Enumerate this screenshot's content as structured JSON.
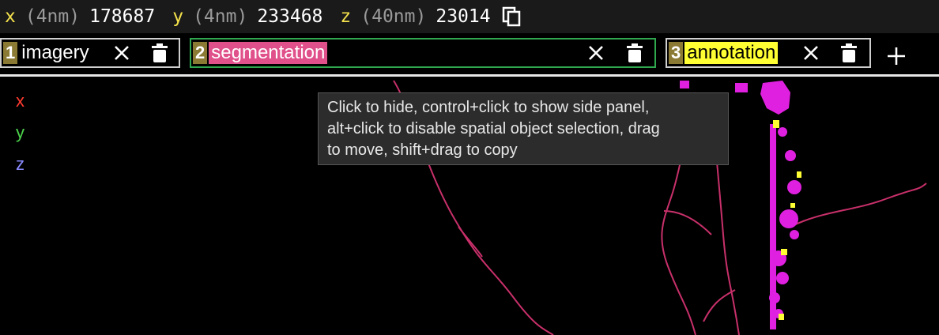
{
  "coordinates": [
    {
      "axis": "x",
      "unit": "(4nm)",
      "value": "178687"
    },
    {
      "axis": "y",
      "unit": "(4nm)",
      "value": "233468"
    },
    {
      "axis": "z",
      "unit": "(40nm)",
      "value": "23014"
    }
  ],
  "layers": [
    {
      "number": "1",
      "name": "imagery",
      "name_bg": "#000000",
      "name_color": "#ffffff"
    },
    {
      "number": "2",
      "name": "segmentation",
      "name_bg": "#e0508a",
      "name_color": "#ffffff",
      "border": "#2fa84f"
    },
    {
      "number": "3",
      "name": "annotation",
      "name_bg": "#ffff33",
      "name_color": "#000000"
    }
  ],
  "axes_labels": {
    "x": "x",
    "y": "y",
    "z": "z"
  },
  "axis_colors": {
    "x": "#ff3b2f",
    "y": "#4cd44c",
    "z": "#8a8aff"
  },
  "tooltip": {
    "line1": "Click to hide, control+click to show side panel,",
    "line2": "alt+click to disable spatial object selection, drag",
    "line3": "to move, shift+drag to copy"
  },
  "colors": {
    "neuron_magenta": "#e020e0",
    "neurite": "#c8306a",
    "annotation_yellow": "#ffff33"
  }
}
